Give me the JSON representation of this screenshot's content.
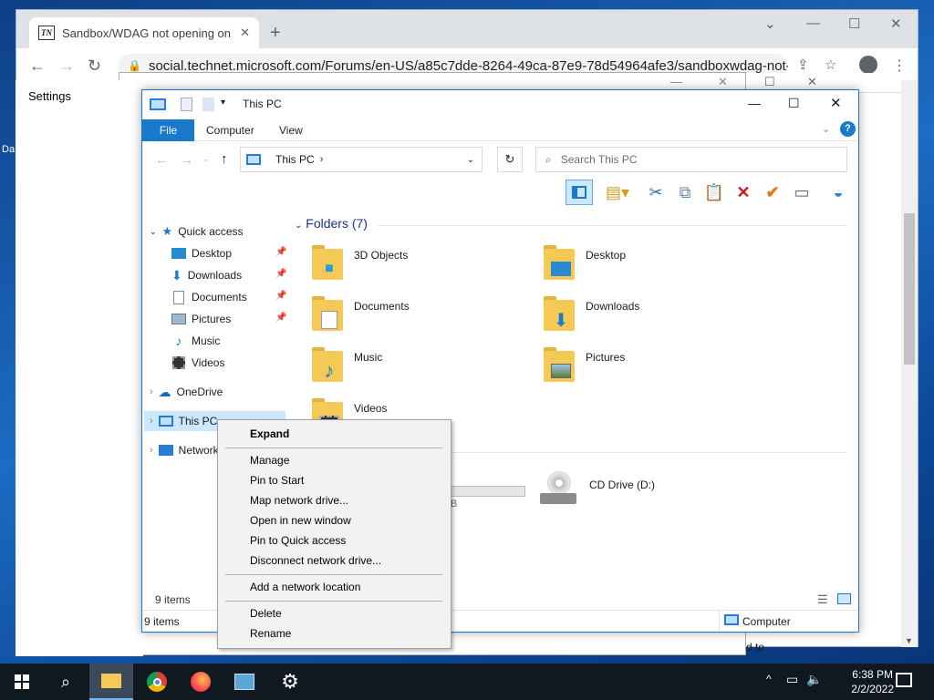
{
  "browser": {
    "tab_title": "Sandbox/WDAG not opening on",
    "tab_icon": "TN",
    "new_tab": "+",
    "url": "social.technet.microsoft.com/Forums/en-US/a85c7dde-8264-49ca-87e9-78d54964afe3/sandboxwdag-not-open..."
  },
  "settings": {
    "title": "Settings"
  },
  "desktop_text": "Da",
  "explorer": {
    "title": "This PC",
    "tabs": [
      "File",
      "Computer",
      "View"
    ],
    "address": "This PC",
    "search_placeholder": "Search This PC",
    "nav": {
      "quick_access": "Quick access",
      "quick_items": [
        "Desktop",
        "Downloads",
        "Documents",
        "Pictures",
        "Music",
        "Videos"
      ],
      "onedrive": "OneDrive",
      "this_pc": "This PC",
      "network": "Network"
    },
    "folders_header": "Folders (7)",
    "folders": [
      "3D Objects",
      "Desktop",
      "Documents",
      "Downloads",
      "Music",
      "Pictures",
      "Videos"
    ],
    "drive": "CD Drive (D:)",
    "drive_partial": "B",
    "status_items": "9 items",
    "status_items2": "9 items",
    "status_computer": "Computer"
  },
  "context_menu": {
    "expand": "Expand",
    "items": [
      "Manage",
      "Pin to Start",
      "Map network drive...",
      "Open in new window",
      "Pin to Quick access",
      "Disconnect network drive..."
    ],
    "add_location": "Add a network location",
    "delete": "Delete",
    "rename": "Rename"
  },
  "bottom_partial": "d to",
  "taskbar": {
    "time": "6:38 PM",
    "date": "2/2/2022"
  },
  "colors": {
    "accent": "#1979ca",
    "folder": "#f4c955",
    "selection": "#cce8ff"
  }
}
